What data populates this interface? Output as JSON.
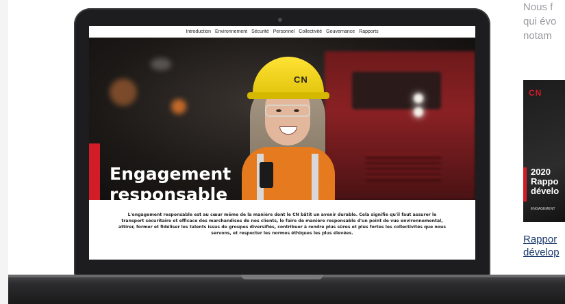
{
  "site_nav": {
    "items": [
      "Introduction",
      "Environnement",
      "Sécurité",
      "Personnel",
      "Collectivité",
      "Gouvernance",
      "Rapports"
    ]
  },
  "hero": {
    "title_line1": "Engagement",
    "title_line2": "responsable",
    "helmet_logo": "CN",
    "accent_color": "#d21c28"
  },
  "intro": {
    "text": "L'engagement responsable est au cœur même de la manière dont le CN bâtit un avenir durable. Cela signifie qu'il faut assurer le transport sécuritaire et efficace des marchandises de nos clients, le faire de manière responsable d'un point de vue environnemental, attirer, former et fidéliser les talents issus de groupes diversifiés, contribuer à rendre plus sûres et plus fortes les collectivités que nous servons, et respecter les normes éthiques les plus élevées."
  },
  "right_column": {
    "text_lines": [
      "Nous f",
      "qui évo",
      "notam"
    ],
    "cover": {
      "logo": "CN",
      "title_lines": [
        "2020",
        "Rappo",
        "dévelo"
      ],
      "subtitle": "ENGAGEMENT"
    },
    "link_lines": [
      "Rappor",
      "dévelop"
    ],
    "link_color": "#1b3a6b"
  }
}
